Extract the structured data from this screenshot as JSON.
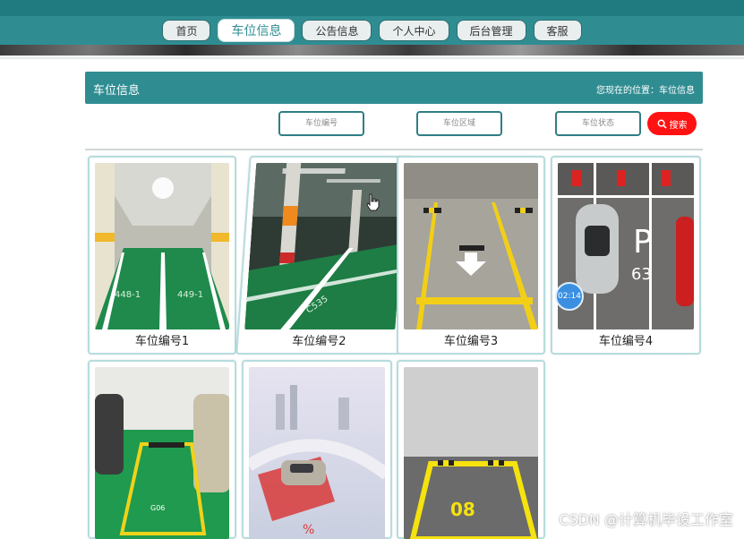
{
  "nav": {
    "items": [
      {
        "label": "首页",
        "active": false
      },
      {
        "label": "车位信息",
        "active": true
      },
      {
        "label": "公告信息",
        "active": false
      },
      {
        "label": "个人中心",
        "active": false
      },
      {
        "label": "后台管理",
        "active": false
      },
      {
        "label": "客服",
        "active": false
      }
    ]
  },
  "header": {
    "title": "车位信息",
    "breadcrumb": "您现在的位置：车位信息"
  },
  "search": {
    "number_placeholder": "车位编号",
    "area_placeholder": "车位区域",
    "status_placeholder": "车位状态",
    "button_label": "搜索"
  },
  "cards": [
    {
      "label": "车位编号1"
    },
    {
      "label": "车位编号2"
    },
    {
      "label": "车位编号3"
    },
    {
      "label": "车位编号4"
    },
    {
      "label": ""
    },
    {
      "label": ""
    },
    {
      "label": ""
    }
  ],
  "overlay": {
    "timer": "02:14"
  },
  "watermark": "CSDN @计算机毕设工作室",
  "colors": {
    "primary": "#2f8d92",
    "search_button": "#ff1212",
    "parking_green": "#1a9a4d",
    "line_yellow": "#f2d21a"
  }
}
